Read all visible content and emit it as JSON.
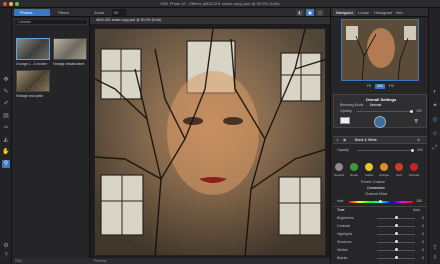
{
  "window": {
    "title": "ON1 Photo 10 - Effects (d842-001 smart copy).psd @ 50.0% (8-bit)"
  },
  "browser": {
    "tabs": [
      {
        "label": "Photos"
      },
      {
        "label": "Filters"
      }
    ],
    "path": "Lohman",
    "thumbs": [
      {
        "label": "Grunge L…k border"
      },
      {
        "label": "Vintage desaturated"
      },
      {
        "label": "Vintage and plate"
      }
    ],
    "footer": "ON1"
  },
  "canvas": {
    "zoom_label": "Zoom",
    "zoom_value": "50",
    "file_tab": "d842-001 smart copy.psd @ 50.0% (8-bit)",
    "footer": "Preview"
  },
  "right": {
    "tabs": [
      {
        "label": "Navigator"
      },
      {
        "label": "Loupe"
      },
      {
        "label": "Histogram"
      },
      {
        "label": "Info"
      }
    ],
    "zoom_buttons": [
      {
        "label": "Fit"
      },
      {
        "label": "100"
      },
      {
        "label": "Fill"
      }
    ],
    "overall": {
      "title": "Overall Settings",
      "blending_label": "Blending Mode",
      "blending_value": "Normal",
      "opacity_label": "Opacity",
      "opacity_value": "100"
    },
    "bw": {
      "title": "Black & White",
      "opacity_label": "Opacity",
      "opacity_value": "100"
    },
    "colors": [
      {
        "label": "Neutral",
        "color": "#8a8a8a"
      },
      {
        "label": "Green",
        "color": "#3c9a3c"
      },
      {
        "label": "Yellow",
        "color": "#e3c82c"
      },
      {
        "label": "Orange",
        "color": "#e08a2a"
      },
      {
        "label": "Red",
        "color": "#d33a2a"
      },
      {
        "label": "Infrared",
        "color": "#c4222a"
      }
    ],
    "preset_label": "Preset: Custom",
    "conversion_label": "Conversion",
    "channel_mixer_label": "Channel Mixer",
    "hue_label": "Hue",
    "hue_value": "180",
    "tone_label": "Tone",
    "tone_auto": "Auto",
    "tone_rows": [
      {
        "label": "Brightness",
        "value": "0",
        "level": 0.5
      },
      {
        "label": "Contrast",
        "value": "0",
        "level": 0.5
      },
      {
        "label": "Highlights",
        "value": "0",
        "level": 0.5
      },
      {
        "label": "Shadows",
        "value": "0",
        "level": 0.5
      },
      {
        "label": "Whites",
        "value": "0",
        "level": 0.5
      },
      {
        "label": "Blacks",
        "value": "0",
        "level": 0.5
      }
    ]
  }
}
